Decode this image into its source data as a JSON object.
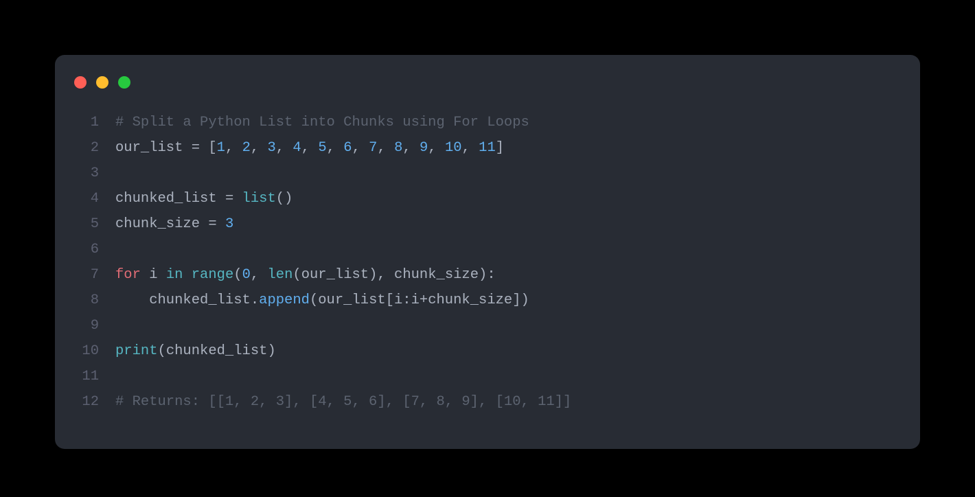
{
  "window": {
    "dots": [
      "close",
      "minimize",
      "zoom"
    ]
  },
  "colors": {
    "background": "#282c34",
    "comment": "#5c6370",
    "default": "#abb2bf",
    "number": "#61afef",
    "keyword": "#c678dd",
    "builtin": "#56b6c2",
    "func": "#61afef",
    "ctrlFor": "#e06c75",
    "ctrlIn": "#56b6c2"
  },
  "code": {
    "language": "python",
    "lines": [
      {
        "n": "1",
        "tokens": [
          {
            "t": "# Split a Python List into Chunks using For Loops",
            "c": "comment"
          }
        ]
      },
      {
        "n": "2",
        "tokens": [
          {
            "t": "our_list ",
            "c": "default"
          },
          {
            "t": "= ",
            "c": "operator"
          },
          {
            "t": "[",
            "c": "bracket"
          },
          {
            "t": "1",
            "c": "number"
          },
          {
            "t": ", ",
            "c": "default"
          },
          {
            "t": "2",
            "c": "number"
          },
          {
            "t": ", ",
            "c": "default"
          },
          {
            "t": "3",
            "c": "number"
          },
          {
            "t": ", ",
            "c": "default"
          },
          {
            "t": "4",
            "c": "number"
          },
          {
            "t": ", ",
            "c": "default"
          },
          {
            "t": "5",
            "c": "number"
          },
          {
            "t": ", ",
            "c": "default"
          },
          {
            "t": "6",
            "c": "number"
          },
          {
            "t": ", ",
            "c": "default"
          },
          {
            "t": "7",
            "c": "number"
          },
          {
            "t": ", ",
            "c": "default"
          },
          {
            "t": "8",
            "c": "number"
          },
          {
            "t": ", ",
            "c": "default"
          },
          {
            "t": "9",
            "c": "number"
          },
          {
            "t": ", ",
            "c": "default"
          },
          {
            "t": "10",
            "c": "number"
          },
          {
            "t": ", ",
            "c": "default"
          },
          {
            "t": "11",
            "c": "number"
          },
          {
            "t": "]",
            "c": "bracket"
          }
        ]
      },
      {
        "n": "3",
        "tokens": []
      },
      {
        "n": "4",
        "tokens": [
          {
            "t": "chunked_list ",
            "c": "default"
          },
          {
            "t": "= ",
            "c": "operator"
          },
          {
            "t": "list",
            "c": "builtin"
          },
          {
            "t": "()",
            "c": "bracket"
          }
        ]
      },
      {
        "n": "5",
        "tokens": [
          {
            "t": "chunk_size ",
            "c": "default"
          },
          {
            "t": "= ",
            "c": "operator"
          },
          {
            "t": "3",
            "c": "number"
          }
        ]
      },
      {
        "n": "6",
        "tokens": []
      },
      {
        "n": "7",
        "tokens": [
          {
            "t": "for",
            "c": "ctrl-for"
          },
          {
            "t": " i ",
            "c": "default"
          },
          {
            "t": "in",
            "c": "ctrl-in"
          },
          {
            "t": " ",
            "c": "default"
          },
          {
            "t": "range",
            "c": "builtin"
          },
          {
            "t": "(",
            "c": "bracket"
          },
          {
            "t": "0",
            "c": "number"
          },
          {
            "t": ", ",
            "c": "default"
          },
          {
            "t": "len",
            "c": "builtin"
          },
          {
            "t": "(our_list), chunk_size)",
            "c": "default"
          },
          {
            "t": ":",
            "c": "default"
          }
        ]
      },
      {
        "n": "8",
        "tokens": [
          {
            "t": "    chunked_list.",
            "c": "default"
          },
          {
            "t": "append",
            "c": "func"
          },
          {
            "t": "(our_list[i:i",
            "c": "default"
          },
          {
            "t": "+",
            "c": "operator"
          },
          {
            "t": "chunk_size])",
            "c": "default"
          }
        ]
      },
      {
        "n": "9",
        "tokens": []
      },
      {
        "n": "10",
        "tokens": [
          {
            "t": "print",
            "c": "builtin"
          },
          {
            "t": "(chunked_list)",
            "c": "default"
          }
        ]
      },
      {
        "n": "11",
        "tokens": []
      },
      {
        "n": "12",
        "tokens": [
          {
            "t": "# Returns: [[1, 2, 3], [4, 5, 6], [7, 8, 9], [10, 11]]",
            "c": "comment"
          }
        ]
      }
    ]
  }
}
